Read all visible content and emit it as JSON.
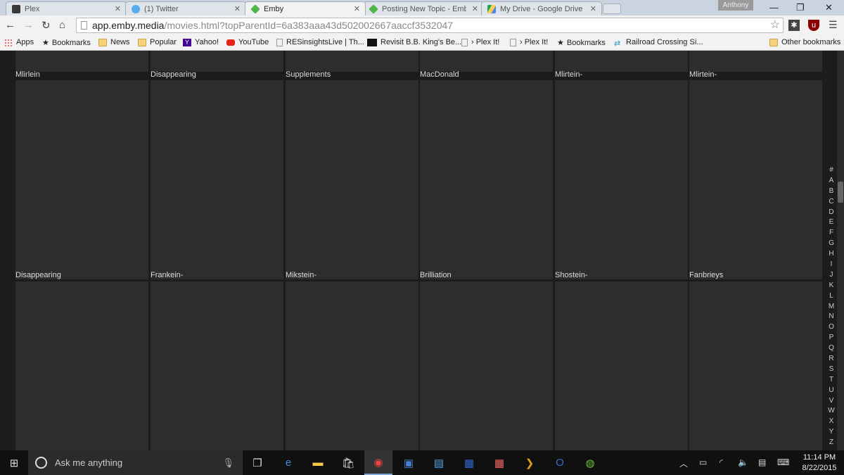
{
  "browser": {
    "tabs": [
      {
        "title": "Plex",
        "icon": "plex-icon"
      },
      {
        "title": "(1) Twitter",
        "icon": "twitter-icon"
      },
      {
        "title": "Emby",
        "icon": "emby-icon",
        "active": true
      },
      {
        "title": "Posting New Topic - Emby",
        "icon": "emby-icon"
      },
      {
        "title": "My Drive - Google Drive",
        "icon": "google-drive-icon"
      }
    ],
    "user": "Anthony",
    "url_host": "app.emby.media",
    "url_path": "/movies.html?topParentId=6a383aaa43d502002667aaccf3532047",
    "bookmarks": [
      "Apps",
      "Bookmarks",
      "News",
      "Popular",
      "Yahoo!",
      "YouTube",
      "RESinsightsLive | Th...",
      "Revisit B.B. King's Be...",
      "› Plex It!",
      "› Plex It!",
      "Bookmarks",
      "Railroad Crossing Si..."
    ],
    "other_bookmarks": "Other bookmarks"
  },
  "grid": {
    "row1_labels": [
      "Mlirlein",
      "Disappearing",
      "Supplements",
      "MacDonald",
      "Mlirtein-",
      "Mlirtein-"
    ],
    "row2_labels": [
      "Disappearing",
      "Frankein-",
      "Mikstein-",
      "Brilliation",
      "Shostein-",
      "Fanbrieys"
    ]
  },
  "alpha_index": [
    "#",
    "A",
    "B",
    "C",
    "D",
    "E",
    "F",
    "G",
    "H",
    "I",
    "J",
    "K",
    "L",
    "M",
    "N",
    "O",
    "P",
    "Q",
    "R",
    "S",
    "T",
    "U",
    "V",
    "W",
    "X",
    "Y",
    "Z"
  ],
  "taskbar": {
    "search_placeholder": "Ask me anything",
    "time": "11:14 PM",
    "date": "8/22/2015"
  }
}
